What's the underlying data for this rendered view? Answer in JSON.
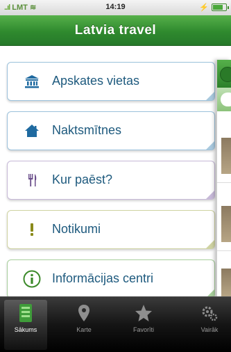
{
  "status_bar": {
    "carrier": "LMT",
    "time": "14:19",
    "battery_level": 0.8
  },
  "nav": {
    "title": "Latvia travel"
  },
  "menu": [
    {
      "label": "Apskates vietas",
      "icon": "landmark-icon"
    },
    {
      "label": "Naktsmītnes",
      "icon": "house-icon"
    },
    {
      "label": "Kur paēst?",
      "icon": "fork-knife-icon"
    },
    {
      "label": "Notikumi",
      "icon": "exclamation-icon"
    },
    {
      "label": "Informācijas centri",
      "icon": "info-icon"
    }
  ],
  "tabs": [
    {
      "label": "Sākums",
      "icon": "home-icon",
      "active": true
    },
    {
      "label": "Karte",
      "icon": "map-pin-icon",
      "active": false
    },
    {
      "label": "Favorīti",
      "icon": "star-icon",
      "active": false
    },
    {
      "label": "Vairāk",
      "icon": "gears-icon",
      "active": false
    }
  ],
  "colors": {
    "nav_green": "#2f8a2e",
    "label_blue": "#1e5a7e",
    "icon_blue": "#1f6aa0",
    "icon_purple": "#6a4d8a",
    "icon_olive": "#8a8a1a",
    "icon_green": "#3c8a2a"
  }
}
